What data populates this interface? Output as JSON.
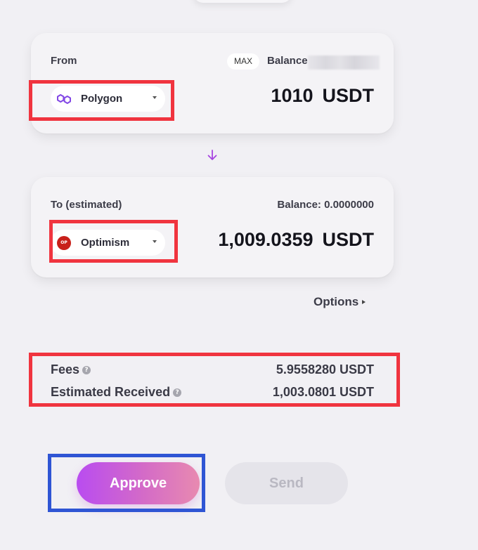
{
  "from_card": {
    "label": "From",
    "max_label": "MAX",
    "balance_label": "Balance",
    "chain": {
      "name": "Polygon",
      "icon": "polygon-icon",
      "icon_color": "#8247e5"
    },
    "amount": "1010",
    "token": "USDT"
  },
  "to_card": {
    "label": "To (estimated)",
    "balance_label": "Balance: 0.0000000",
    "chain": {
      "name": "Optimism",
      "icon": "optimism-icon",
      "icon_text": "OP",
      "icon_color": "#c8201a"
    },
    "amount": "1,009.0359",
    "token": "USDT"
  },
  "swap_icon": {
    "name": "arrow-down-icon",
    "color": "#a745e0"
  },
  "options": {
    "label": "Options"
  },
  "fees": [
    {
      "label": "Fees",
      "value": "5.9558280 USDT"
    },
    {
      "label": "Estimated Received",
      "value": "1,003.0801 USDT"
    }
  ],
  "actions": {
    "approve_label": "Approve",
    "send_label": "Send"
  },
  "colors": {
    "accent_start": "#b94cf0",
    "accent_end": "#e88ab0",
    "highlight_red": "#f0343f",
    "highlight_blue": "#2f55d4",
    "background": "#f1f0f4"
  }
}
